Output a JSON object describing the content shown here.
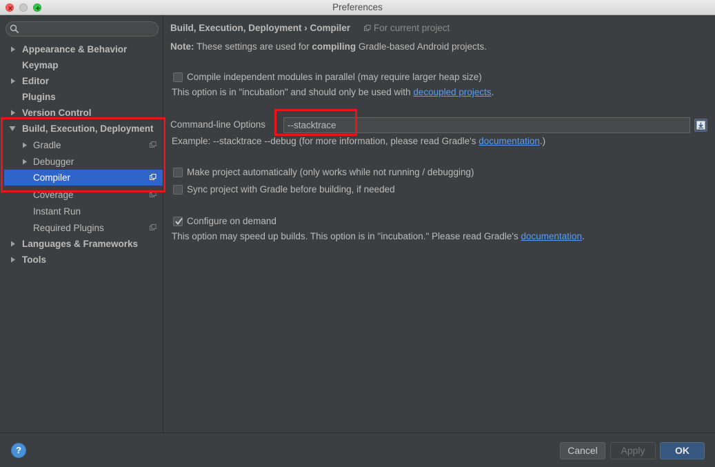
{
  "window": {
    "title": "Preferences"
  },
  "sidebar": {
    "search_placeholder": "",
    "items": [
      {
        "label": "Appearance & Behavior",
        "bold": true,
        "expandable": true
      },
      {
        "label": "Keymap",
        "bold": true
      },
      {
        "label": "Editor",
        "bold": true,
        "expandable": true
      },
      {
        "label": "Plugins",
        "bold": true
      },
      {
        "label": "Version Control",
        "bold": true,
        "expandable": true
      },
      {
        "label": "Build, Execution, Deployment",
        "bold": true,
        "expanded": true
      },
      {
        "label": "Gradle",
        "expandable": true
      },
      {
        "label": "Debugger",
        "expandable": true
      },
      {
        "label": "Compiler",
        "selected": true
      },
      {
        "label": "Coverage"
      },
      {
        "label": "Instant Run"
      },
      {
        "label": "Required Plugins"
      },
      {
        "label": "Languages & Frameworks",
        "bold": true,
        "expandable": true
      },
      {
        "label": "Tools",
        "bold": true,
        "expandable": true
      }
    ]
  },
  "main": {
    "breadcrumb": "Build, Execution, Deployment › Compiler",
    "scope": "For current project",
    "note_label": "Note:",
    "note_text_1": "These settings are used for",
    "note_bold": "compiling",
    "note_text_2": "Gradle-based Android projects.",
    "parallel": {
      "label": "Compile independent modules in parallel (may require larger heap size)",
      "checked": false,
      "hint": "This option is in \"incubation\" and should only be used with",
      "link": "decoupled projects",
      "hint_end": "."
    },
    "cmd": {
      "label": "Command-line Options",
      "value": "--stacktrace",
      "example": "Example: --stacktrace --debug (for more information, please read Gradle's",
      "link": "documentation",
      "example_end": ".)"
    },
    "make_auto": {
      "label": "Make project automatically (only works while not running / debugging)",
      "checked": false
    },
    "sync": {
      "label": "Sync project with Gradle before building, if needed",
      "checked": false
    },
    "configure": {
      "label": "Configure on demand",
      "checked": true,
      "hint": "This option may speed up builds. This option is in \"incubation.\" Please read Gradle's",
      "link": "documentation",
      "hint_end": "."
    }
  },
  "footer": {
    "help": "?",
    "cancel": "Cancel",
    "apply": "Apply",
    "ok": "OK"
  },
  "colors": {
    "selection": "#2f65ca",
    "highlight": "#e8151d",
    "link": "#589df6"
  }
}
